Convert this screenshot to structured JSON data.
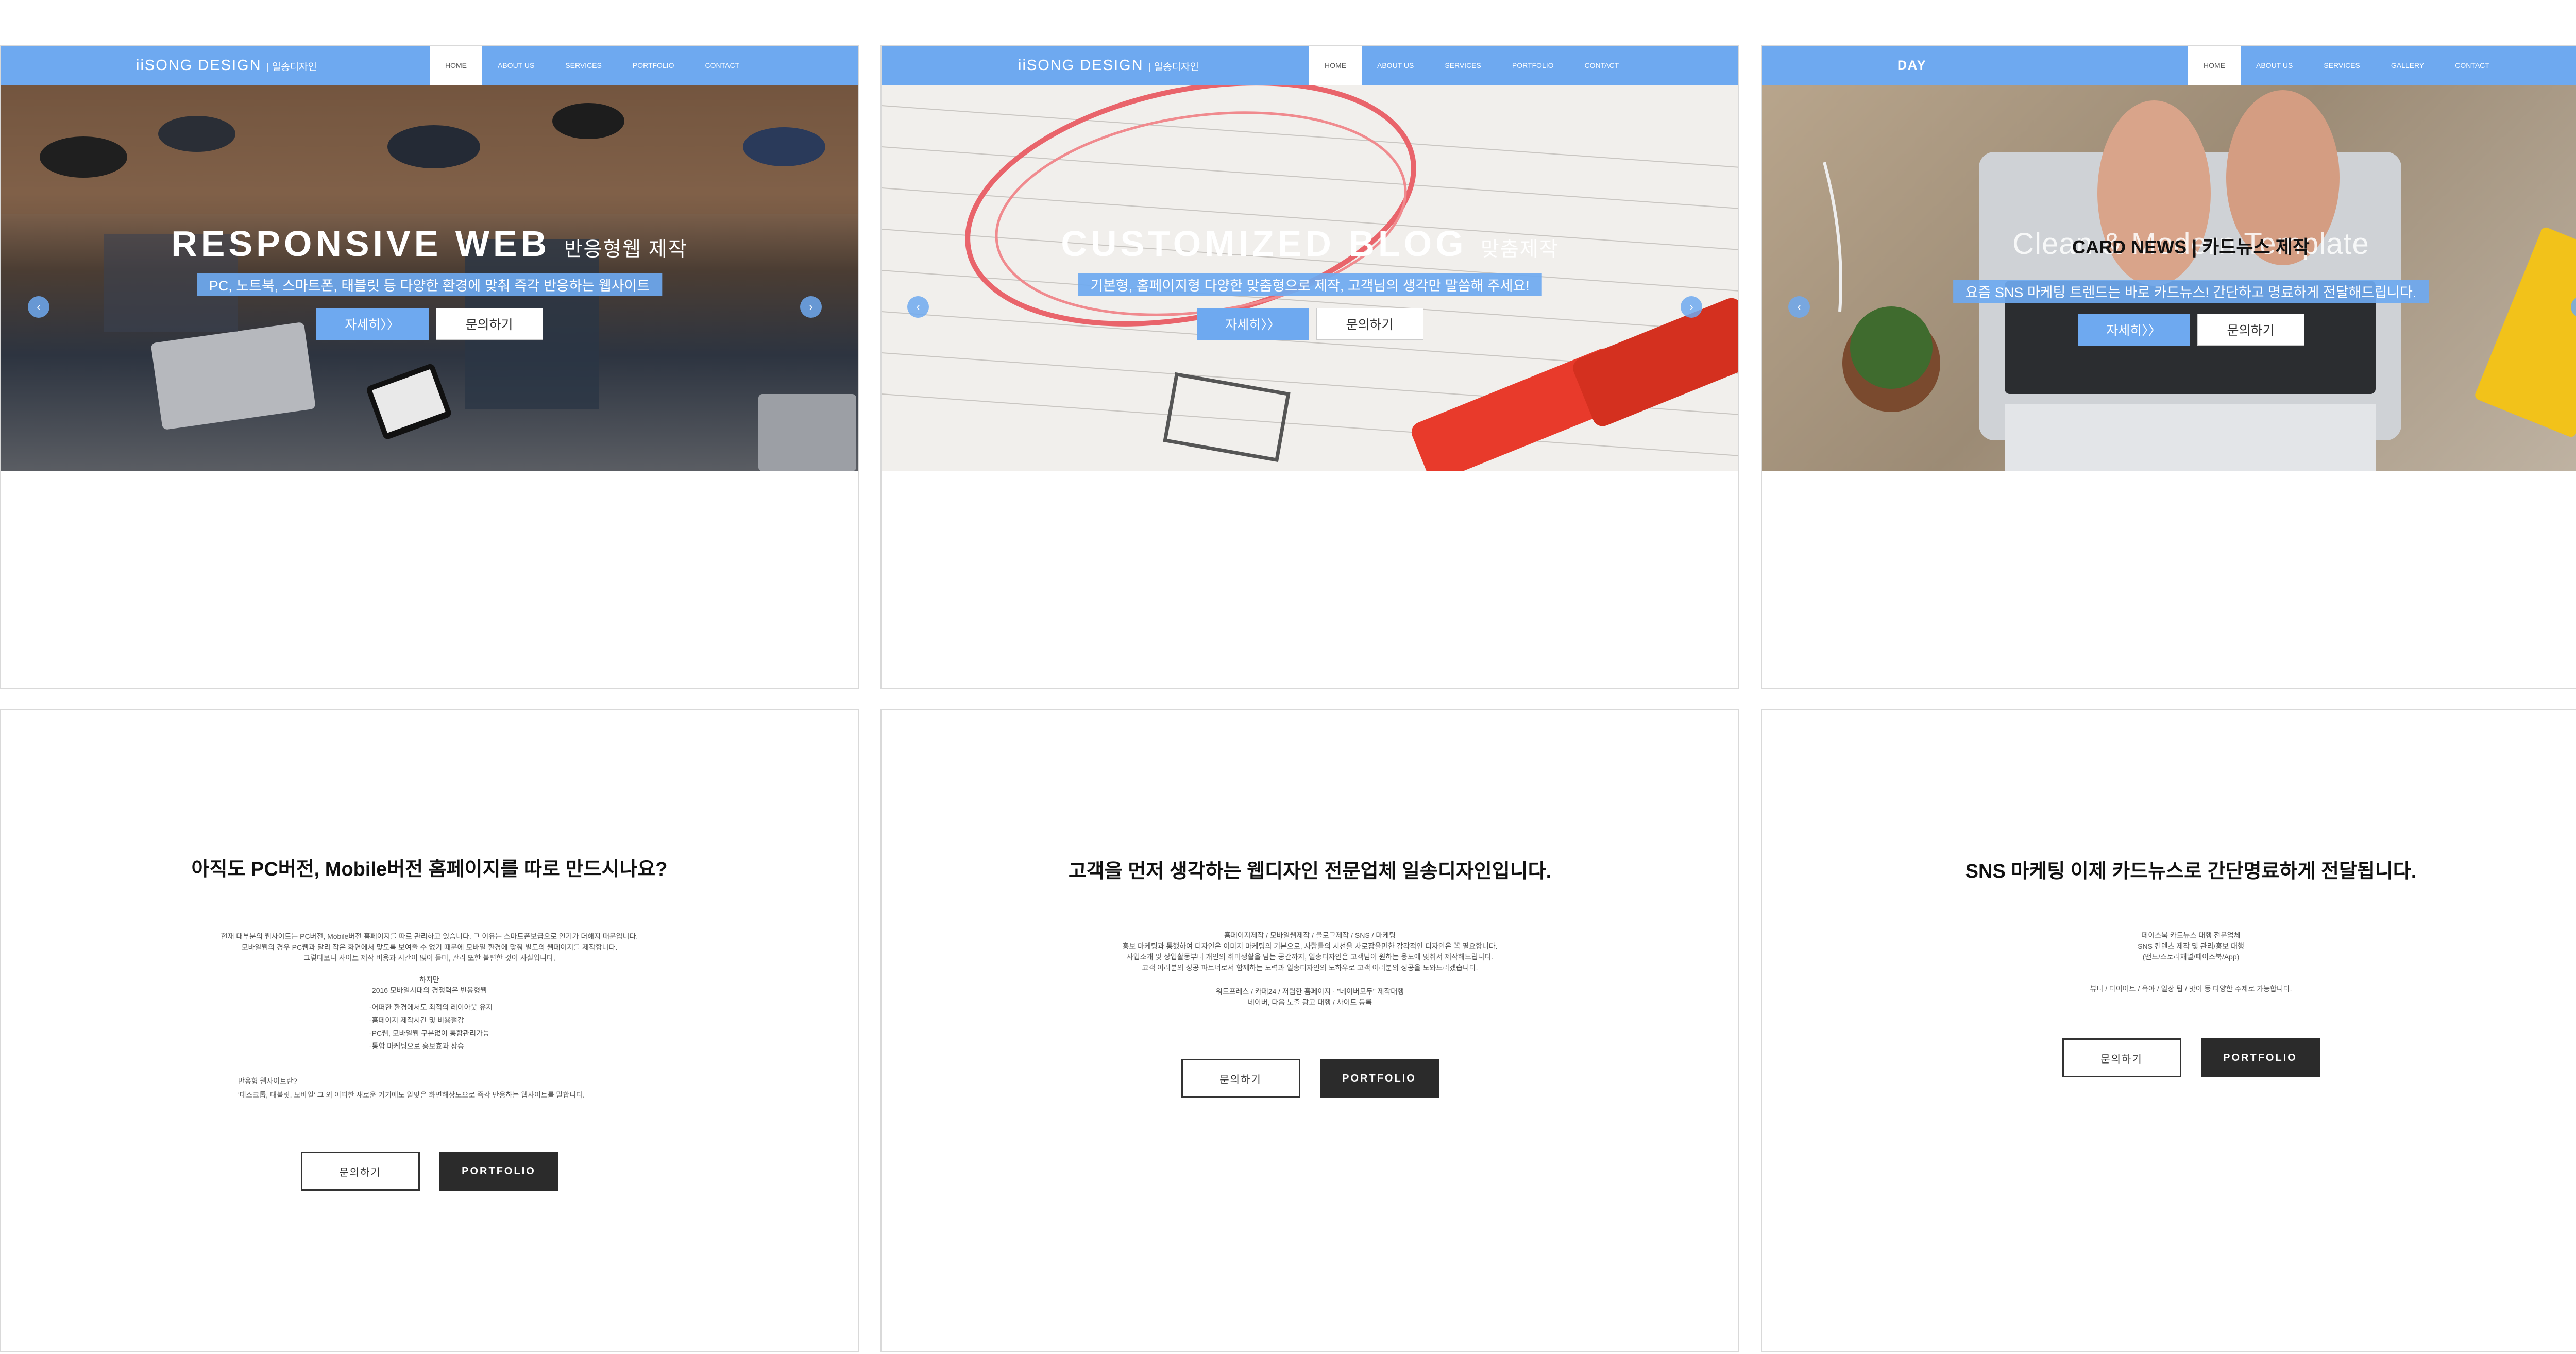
{
  "nav": {
    "menu_1": [
      "HOME",
      "ABOUT US",
      "SERVICES",
      "PORTFOLIO",
      "CONTACT"
    ],
    "menu_3": [
      "HOME",
      "ABOUT US",
      "SERVICES",
      "GALLERY",
      "CONTACT"
    ],
    "logo_1": "iiSONG DESIGN",
    "logo_1_sub": "| 일송디자인",
    "logo_2": "iiSONG DESIGN",
    "logo_2_sub": "| 일송디자인",
    "logo_3": "DAY"
  },
  "slides": [
    {
      "title": "RESPONSIVE WEB",
      "title_sub": "반응형웹 제작",
      "subtitle": "PC, 노트북, 스마트폰, 태블릿 등 다양한 환경에 맞춰 즉각 반응하는 웹사이트",
      "detail": "자세히〉〉",
      "inquiry": "문의하기"
    },
    {
      "title": "CUSTOMIZED BLOG",
      "title_sub": "맞춤제작",
      "subtitle": "기본형, 홈페이지형 다양한 맞춤형으로 제작, 고객님의 생각만 말씀해 주세요!",
      "detail": "자세히〉〉",
      "inquiry": "문의하기"
    },
    {
      "title": "Clean & Modern Template",
      "overlay": "CARD NEWS | 카드뉴스 제작",
      "subtitle": "요즘 SNS 마케팅 트렌드는 바로 카드뉴스! 간단하고 명료하게 전달해드립니다.",
      "detail": "자세히〉〉",
      "inquiry": "문의하기"
    }
  ],
  "content": [
    {
      "heading": "아직도 PC버전, Mobile버전 홈페이지를 따로 만드시나요?",
      "lines": [
        "현재 대부분의 웹사이트는 PC버전, Mobile버전 홈페이지를 따로 관리하고 있습니다. 그 이유는 스마트폰보급으로 인기가 더해지 때문입니다.",
        "모바일웹의 경우 PC웹과 달리 작은 화면에서 맞도록 보여줄 수 없기 때문에 모바일 환경에 맞춰 별도의 웹페이지를 제작합니다.",
        "그렇다보니 사이트 제작 비용과 시간이 많이 들며, 관리 또한 불편한 것이 사실입니다.",
        "하지만",
        "2016 모바일시대의 경쟁력은 반응형웹",
        "-어떠한 환경에서도 최적의 레이아웃 유지",
        "-홈페이지 제작시간 및 비용절감",
        "-PC웹, 모바일웹 구분없이 통합관리가능",
        "-통합 마케팅으로 홍보효과 상승",
        "반응형 웹사이트란?",
        "'데스크톱, 태블릿, 모바일' 그 외 어떠한 새로운 기기에도 알맞은 화면해상도으로 즉각 반응하는 웹사이트를 말합니다."
      ],
      "btn_inquiry": "문의하기",
      "btn_portfolio": "PORTFOLIO"
    },
    {
      "heading": "고객을 먼저 생각하는 웹디자인 전문업체 일송디자인입니다.",
      "lines": [
        "홈페이지제작 / 모바일웹제작 / 블로그제작 / SNS / 마케팅",
        "홍보 마케팅과 통했하여 디자인은 이미지 마케팅의 기본으로, 사람들의 시선을 사로잡을만한 감각적인 디자인은 꼭 필요합니다.",
        "사업소개 및 상업활동부터 개인의 취미생활을 담는 공간까지, 일송디자인은 고객님이 원하는 용도에 맞춰서 제작해드립니다.",
        "고객 여러분의 성공 파트너로서 함께하는 노력과 일송디자인의 노하우로 고객 여러분의 성공을 도와드리겠습니다.",
        "워드프레스 / 카페24 / 저렴한 홈페이지 · \"네이버모두\" 제작대행",
        "네이버, 다음 노출 광고 대행 / 사이트 등록"
      ],
      "btn_inquiry": "문의하기",
      "btn_portfolio": "PORTFOLIO"
    },
    {
      "heading": "SNS 마케팅 이제 카드뉴스로 간단명료하게 전달됩니다.",
      "lines": [
        "페이스북 카드뉴스 대행 전문업체",
        "SNS 컨텐츠 제작 및 관리/홍보 대행",
        "(밴드/스토리채널/페이스북/App)",
        "뷰티 / 다이어트 / 육아 / 일상 팁 / 맛이 등 다양한 주제로 가능합니다."
      ],
      "btn_inquiry": "문의하기",
      "btn_portfolio": "PORTFOLIO"
    }
  ]
}
